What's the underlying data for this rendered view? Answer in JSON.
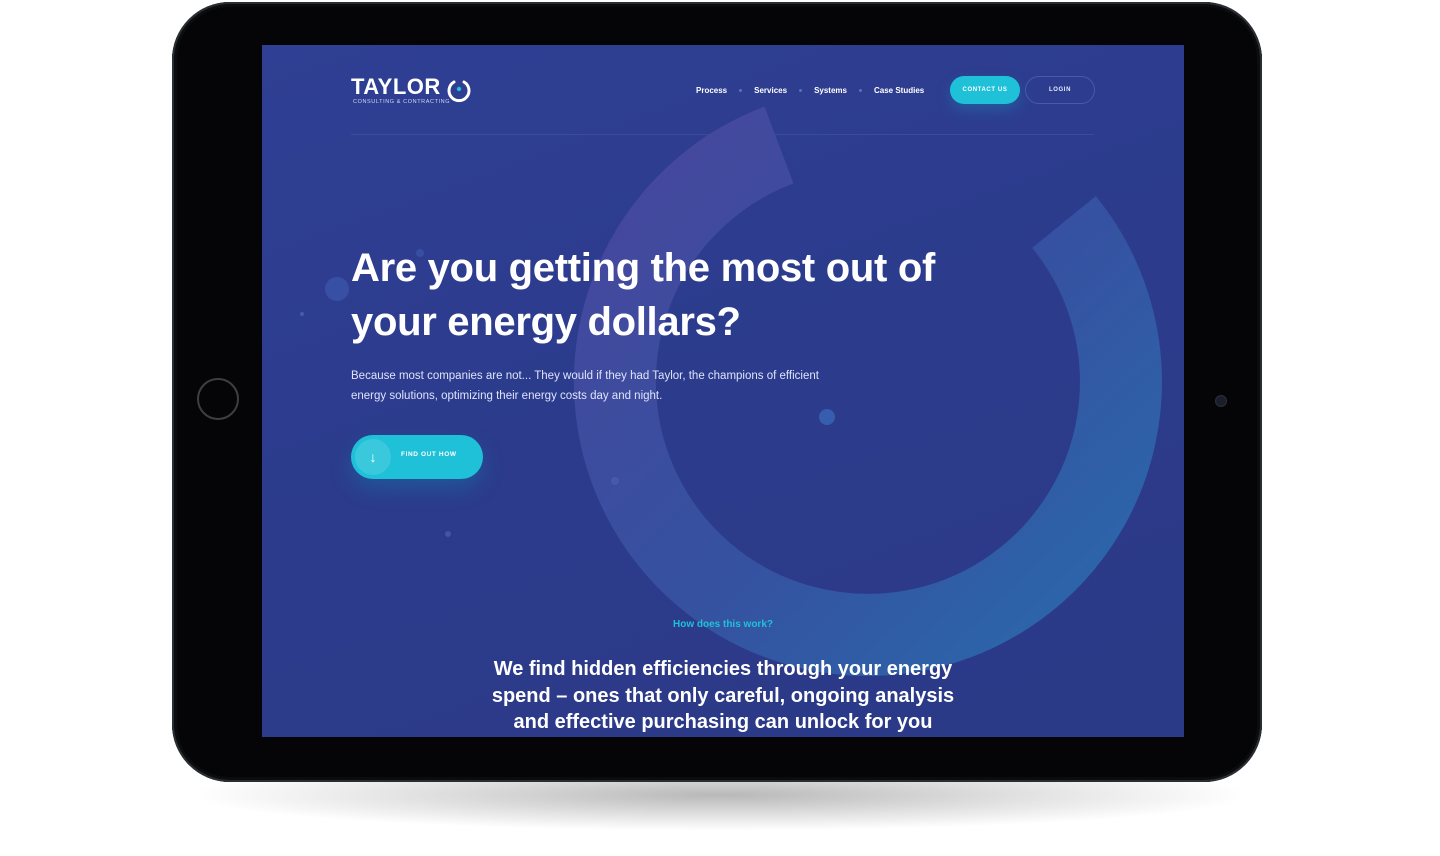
{
  "brand": {
    "name": "TAYLOR",
    "tagline": "CONSULTING & CONTRACTING",
    "accent_color": "#1fc1d9",
    "background_color": "#2f3f93"
  },
  "nav": {
    "items": [
      {
        "label": "Process"
      },
      {
        "label": "Services"
      },
      {
        "label": "Systems"
      },
      {
        "label": "Case Studies"
      }
    ],
    "contact_label": "CONTACT US",
    "login_label": "LOGIN"
  },
  "hero": {
    "title": "Are you getting the most out of your energy dollars?",
    "text": "Because most companies are not... They would if they had Taylor, the champions of efficient energy solutions, optimizing their energy costs day and night.",
    "cta_label": "FIND OUT HOW",
    "cta_icon": "arrow-down-icon",
    "cta_glyph": "↓"
  },
  "how": {
    "eyebrow": "How does this work?",
    "title": "We find hidden efficiencies through your energy spend – ones that only careful, ongoing analysis and effective purchasing can unlock for you"
  },
  "icons": [
    "logo-power-icon",
    "arrow-down-icon",
    "home-button-icon",
    "camera-icon"
  ]
}
